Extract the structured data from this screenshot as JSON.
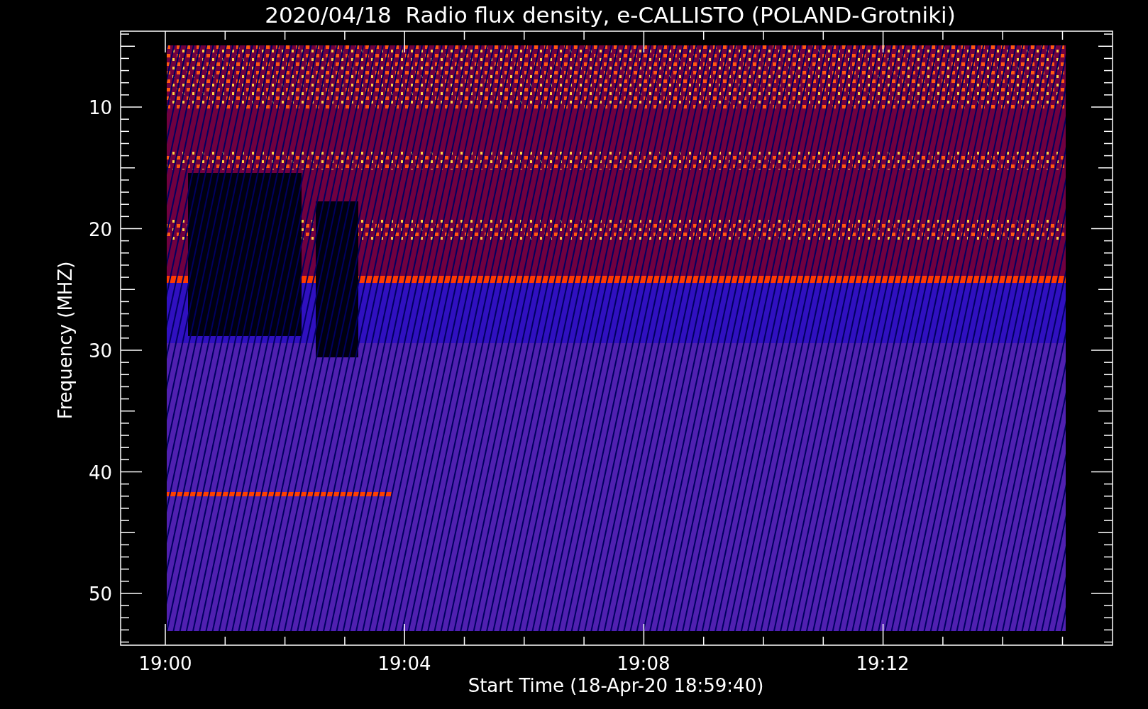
{
  "title": "2020/04/18  Radio flux density, e-CALLISTO (POLAND-Grotniki)",
  "y_axis": {
    "label": "Frequency (MHZ)",
    "ticks": [
      "10",
      "20",
      "30",
      "40",
      "50"
    ]
  },
  "x_axis": {
    "label": "Start Time (18-Apr-20 18:59:40)",
    "ticks": [
      "19:00",
      "19:04",
      "19:08",
      "19:12"
    ]
  }
}
